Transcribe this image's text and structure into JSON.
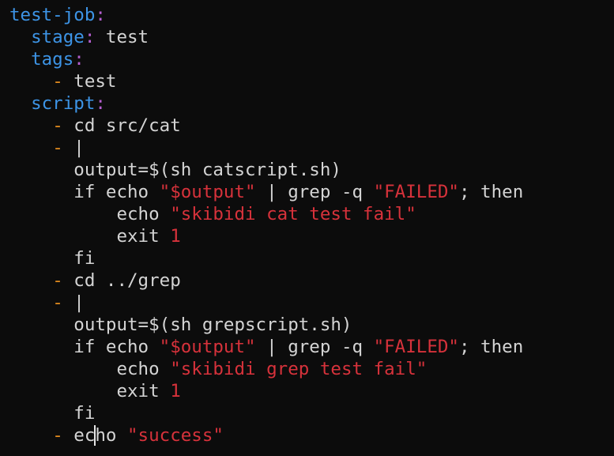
{
  "colors": {
    "background": "#0c0c0c",
    "key": "#3d94e6",
    "punctuation": "#b55fd0",
    "list_dash": "#e08a1e",
    "string": "#d7323b",
    "plain_text": "#d4d4d4"
  },
  "code": {
    "lines": [
      [
        {
          "t": "key",
          "v": "test-job"
        },
        {
          "t": "punc",
          "v": ":"
        }
      ],
      [
        {
          "t": "plain",
          "v": "  "
        },
        {
          "t": "key",
          "v": "stage"
        },
        {
          "t": "punc",
          "v": ":"
        },
        {
          "t": "plain",
          "v": " test"
        }
      ],
      [
        {
          "t": "plain",
          "v": "  "
        },
        {
          "t": "key",
          "v": "tags"
        },
        {
          "t": "punc",
          "v": ":"
        }
      ],
      [
        {
          "t": "plain",
          "v": "    "
        },
        {
          "t": "dash",
          "v": "-"
        },
        {
          "t": "plain",
          "v": " test"
        }
      ],
      [
        {
          "t": "plain",
          "v": "  "
        },
        {
          "t": "key",
          "v": "script"
        },
        {
          "t": "punc",
          "v": ":"
        }
      ],
      [
        {
          "t": "plain",
          "v": "    "
        },
        {
          "t": "dash",
          "v": "-"
        },
        {
          "t": "plain",
          "v": " cd src/cat"
        }
      ],
      [
        {
          "t": "plain",
          "v": "    "
        },
        {
          "t": "dash",
          "v": "-"
        },
        {
          "t": "plain",
          "v": " |"
        }
      ],
      [
        {
          "t": "plain",
          "v": "      output=$(sh catscript.sh)"
        }
      ],
      [
        {
          "t": "plain",
          "v": "      if echo "
        },
        {
          "t": "str",
          "v": "\"$output\""
        },
        {
          "t": "plain",
          "v": " | grep -q "
        },
        {
          "t": "str",
          "v": "\"FAILED\""
        },
        {
          "t": "plain",
          "v": "; then"
        }
      ],
      [
        {
          "t": "plain",
          "v": "          echo "
        },
        {
          "t": "str",
          "v": "\"skibidi cat test fail\""
        }
      ],
      [
        {
          "t": "plain",
          "v": "          exit "
        },
        {
          "t": "num",
          "v": "1"
        }
      ],
      [
        {
          "t": "plain",
          "v": "      fi"
        }
      ],
      [
        {
          "t": "plain",
          "v": "    "
        },
        {
          "t": "dash",
          "v": "-"
        },
        {
          "t": "plain",
          "v": " cd ../grep"
        }
      ],
      [
        {
          "t": "plain",
          "v": "    "
        },
        {
          "t": "dash",
          "v": "-"
        },
        {
          "t": "plain",
          "v": " |"
        }
      ],
      [
        {
          "t": "plain",
          "v": "      output=$(sh grepscript.sh)"
        }
      ],
      [
        {
          "t": "plain",
          "v": "      if echo "
        },
        {
          "t": "str",
          "v": "\"$output\""
        },
        {
          "t": "plain",
          "v": " | grep -q "
        },
        {
          "t": "str",
          "v": "\"FAILED\""
        },
        {
          "t": "plain",
          "v": "; then"
        }
      ],
      [
        {
          "t": "plain",
          "v": "          echo "
        },
        {
          "t": "str",
          "v": "\"skibidi grep test fail\""
        }
      ],
      [
        {
          "t": "plain",
          "v": "          exit "
        },
        {
          "t": "num",
          "v": "1"
        }
      ],
      [
        {
          "t": "plain",
          "v": "      fi"
        }
      ],
      [
        {
          "t": "plain",
          "v": "    "
        },
        {
          "t": "dash",
          "v": "-"
        },
        {
          "t": "plain",
          "v": " ec"
        },
        {
          "t": "cursor",
          "v": ""
        },
        {
          "t": "plain",
          "v": "ho "
        },
        {
          "t": "str",
          "v": "\"success\""
        }
      ]
    ]
  }
}
